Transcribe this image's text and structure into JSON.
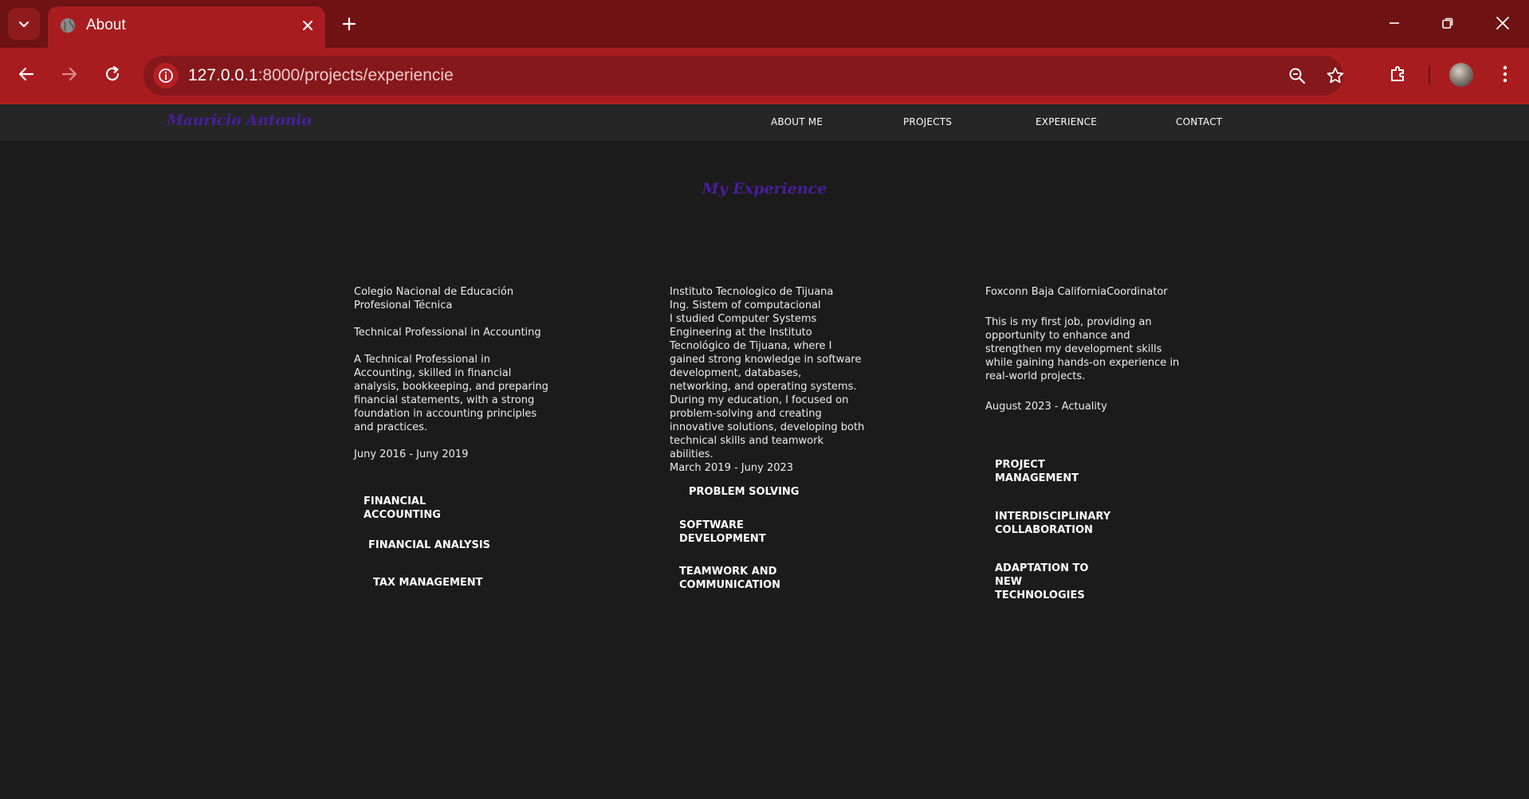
{
  "browser": {
    "tab_title": "About",
    "url_host": "127.0.0.1",
    "url_rest": ":8000/projects/experiencie"
  },
  "site": {
    "brand": "Mauricio Antonio",
    "nav": [
      "ABOUT ME",
      "PROJECTS",
      "EXPERIENCE",
      "CONTACT"
    ]
  },
  "section_title": "My Experience",
  "columns": [
    {
      "institution": "Colegio Nacional de Educación Profesional Técnica",
      "degree": "Technical Professional in Accounting",
      "description": "A Technical Professional in Accounting, skilled in financial analysis, bookkeeping, and preparing financial statements, with a strong foundation in accounting principles and practices.",
      "dates": "Juny 2016 - Juny 2019",
      "skills": [
        "FINANCIAL ACCOUNTING",
        "FINANCIAL ANALYSIS",
        "TAX MANAGEMENT"
      ]
    },
    {
      "institution": "Instituto Tecnologico de Tijuana",
      "degree": "Ing. Sistem of computacional",
      "description": "I studied Computer Systems Engineering at the Instituto Tecnológico de Tijuana, where I gained strong knowledge in software development, databases, networking, and operating systems. During my education, I focused on problem-solving and creating innovative solutions, developing both technical skills and teamwork abilities.",
      "dates": "March 2019 - Juny 2023",
      "skills": [
        "PROBLEM SOLVING",
        "SOFTWARE DEVELOPMENT",
        "TEAMWORK AND COMMUNICATION"
      ]
    },
    {
      "institution": "Foxconn Baja CaliforniaCoordinator",
      "description": "This is my first job, providing an opportunity to enhance and strengthen my development skills while gaining hands-on experience in real-world projects.",
      "dates": "August 2023 - Actuality",
      "skills": [
        "PROJECT MANAGEMENT",
        "INTERDISCIPLINARY COLLABORATION",
        "ADAPTATION TO NEW TECHNOLOGIES"
      ]
    }
  ],
  "colors": {
    "tab_strip": "#6e1214",
    "toolbar": "#a81c20",
    "accent_purple": "#4b1c9b",
    "page_bg": "#1b1b1b",
    "nav_bg": "#262626"
  }
}
